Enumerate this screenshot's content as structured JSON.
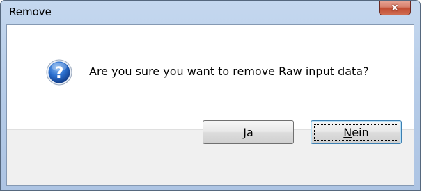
{
  "window": {
    "title": "Remove",
    "close_glyph": "x"
  },
  "dialog": {
    "icon": "question-icon",
    "message": "Are you sure you want to remove Raw input data?"
  },
  "buttons": {
    "yes": {
      "accel": "J",
      "rest": "a"
    },
    "no": {
      "accel": "N",
      "rest": "ein"
    }
  },
  "colors": {
    "titlebar": "#b6cce8",
    "close_button": "#c24d33",
    "icon_blue": "#1f5fb8",
    "footer": "#f0f0f0"
  }
}
